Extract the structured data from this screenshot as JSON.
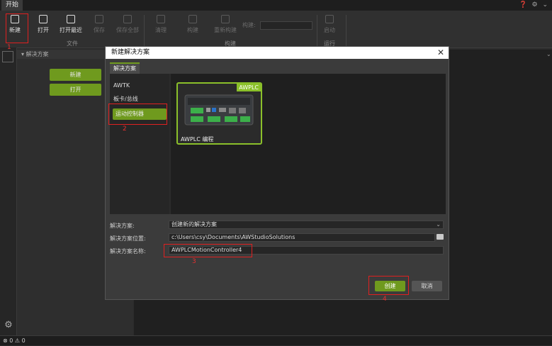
{
  "tabbar": {
    "start_tab": "开始",
    "right_icons": "❓ ⚙ ⌄"
  },
  "ribbon": {
    "buttons": [
      {
        "label": "新建",
        "icon": "new-file-icon"
      },
      {
        "label": "打开",
        "icon": "open-folder-icon"
      },
      {
        "label": "打开最近",
        "icon": "recent-icon"
      },
      {
        "label": "保存",
        "icon": "save-icon"
      },
      {
        "label": "保存全部",
        "icon": "save-all-icon"
      },
      {
        "label": "清理",
        "icon": "clean-icon"
      },
      {
        "label": "构建",
        "icon": "build-icon"
      },
      {
        "label": "重新构建",
        "icon": "rebuild-icon"
      },
      {
        "label": "构建:",
        "icon": ""
      },
      {
        "label": "启动",
        "icon": "run-icon"
      }
    ],
    "groups": [
      "文件",
      "构建",
      "运行"
    ]
  },
  "sidebar": {
    "header": "解决方案",
    "new_button": "新建",
    "open_button": "打开"
  },
  "annotations": [
    "1",
    "2",
    "3",
    "4"
  ],
  "status": {
    "errors": "0",
    "warnings": "0"
  },
  "dialog": {
    "title": "新建解决方案",
    "tab": "解决方案",
    "categories": [
      "AWTK",
      "板卡/总线",
      "运动控制器"
    ],
    "template": {
      "badge": "AWPLC",
      "label": "AWPLC 编程"
    },
    "form": {
      "solution_label": "解决方案:",
      "solution_value": "创建新的解决方案",
      "location_label": "解决方案位置:",
      "location_value": "c:\\Users\\csy\\Documents\\AWStudioSolutions",
      "name_label": "解决方案名称:",
      "name_value": "AWPLCMotionController4"
    },
    "create_button": "创建",
    "cancel_button": "取消"
  }
}
